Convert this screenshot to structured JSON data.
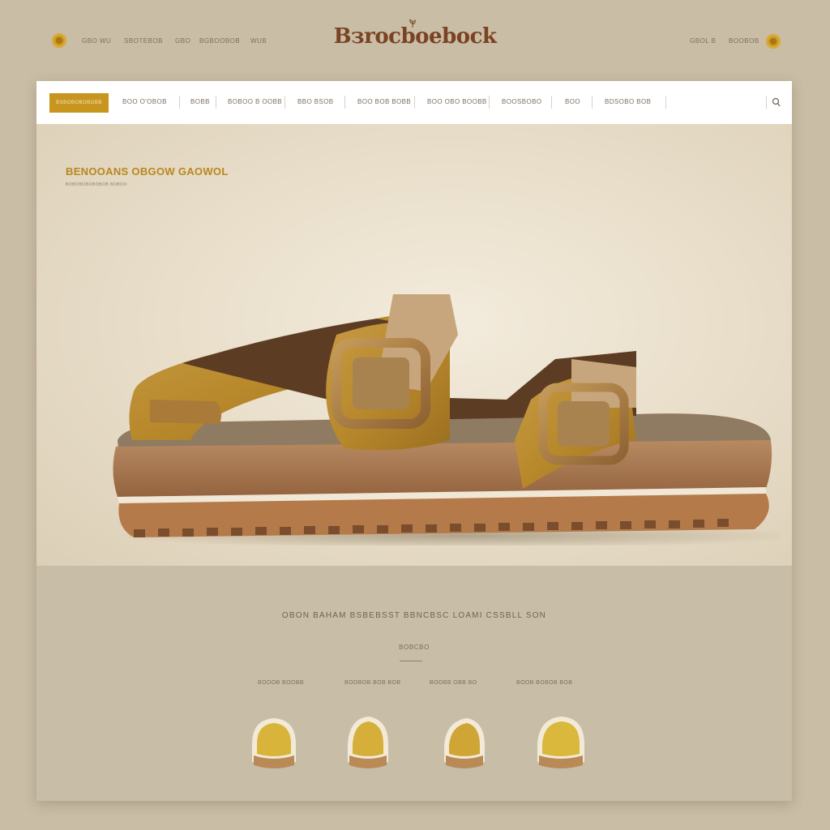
{
  "header": {
    "brand": "Bзroсbоebock",
    "left_links": [
      "GBO  WU",
      "SBOTEBOB",
      "GBO",
      "BGBOOBOB",
      "WUB"
    ],
    "right_links": [
      "GBOL  B",
      "BOOBOB"
    ]
  },
  "nav": {
    "cta_label": "BSBOBOBOBOBB",
    "items": [
      "BOO  O'OBOB",
      "BOBB",
      "BOBOO  B  OOBB",
      "BBO BSOB",
      "BOO BOB BOBB",
      "BOO OBO BOOBB",
      "BOOSBOBO",
      "BOO",
      "BDSOBO  BOB"
    ]
  },
  "hero": {
    "title": "BENOOANS  OBGOW GAOWOL",
    "subtitle": "BOBOBOBOBOBOB   BOBOO"
  },
  "lower": {
    "tagline": "OBON BAHAM  BSBEBSST BBNCBSC  LOAMI  CSSBLL SON",
    "shop_label": "BOBCBO",
    "products": [
      {
        "label": "BOOOB BOOBB"
      },
      {
        "label": "BOOBOB BOB BOB"
      },
      {
        "label": "BOOBB OBB BO"
      },
      {
        "label": "BOOB BOBOB BOB"
      }
    ]
  },
  "colors": {
    "background": "#c9bda6",
    "accent": "#c8961e",
    "brand": "#7a4323",
    "hero": "#ece3d2",
    "nav": "#ffffff"
  }
}
